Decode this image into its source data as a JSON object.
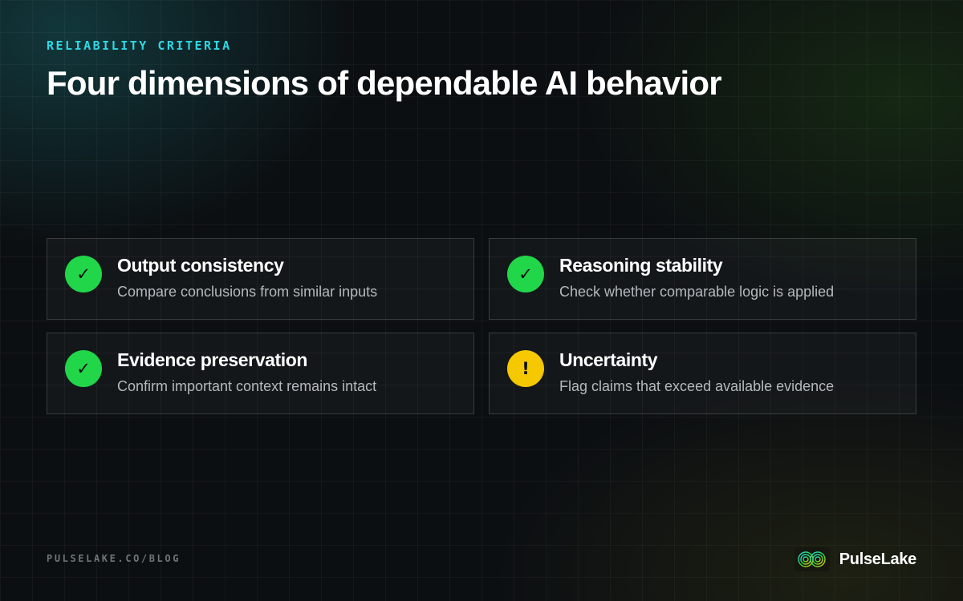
{
  "eyebrow": "RELIABILITY CRITERIA",
  "headline": "Four dimensions of dependable AI behavior",
  "cards": [
    {
      "status": "check",
      "icon": "check-icon",
      "glyph": "✓",
      "title": "Output consistency",
      "description": "Compare conclusions from similar inputs"
    },
    {
      "status": "check",
      "icon": "check-icon",
      "glyph": "✓",
      "title": "Reasoning stability",
      "description": "Check whether comparable logic is applied"
    },
    {
      "status": "check",
      "icon": "check-icon",
      "glyph": "✓",
      "title": "Evidence preservation",
      "description": "Confirm important context remains intact"
    },
    {
      "status": "warning",
      "icon": "exclamation-icon",
      "glyph": "!",
      "title": "Uncertainty",
      "description": "Flag claims that exceed available evidence"
    }
  ],
  "footer": {
    "url": "PULSELAKE.CO/BLOG",
    "brand_name": "PulseLake",
    "logo_icon": "pulselake-logo-icon"
  },
  "colors": {
    "accent": "#2fd8e4",
    "check": "#22d64a",
    "warning": "#f5c800",
    "background": "#0c0f12"
  }
}
